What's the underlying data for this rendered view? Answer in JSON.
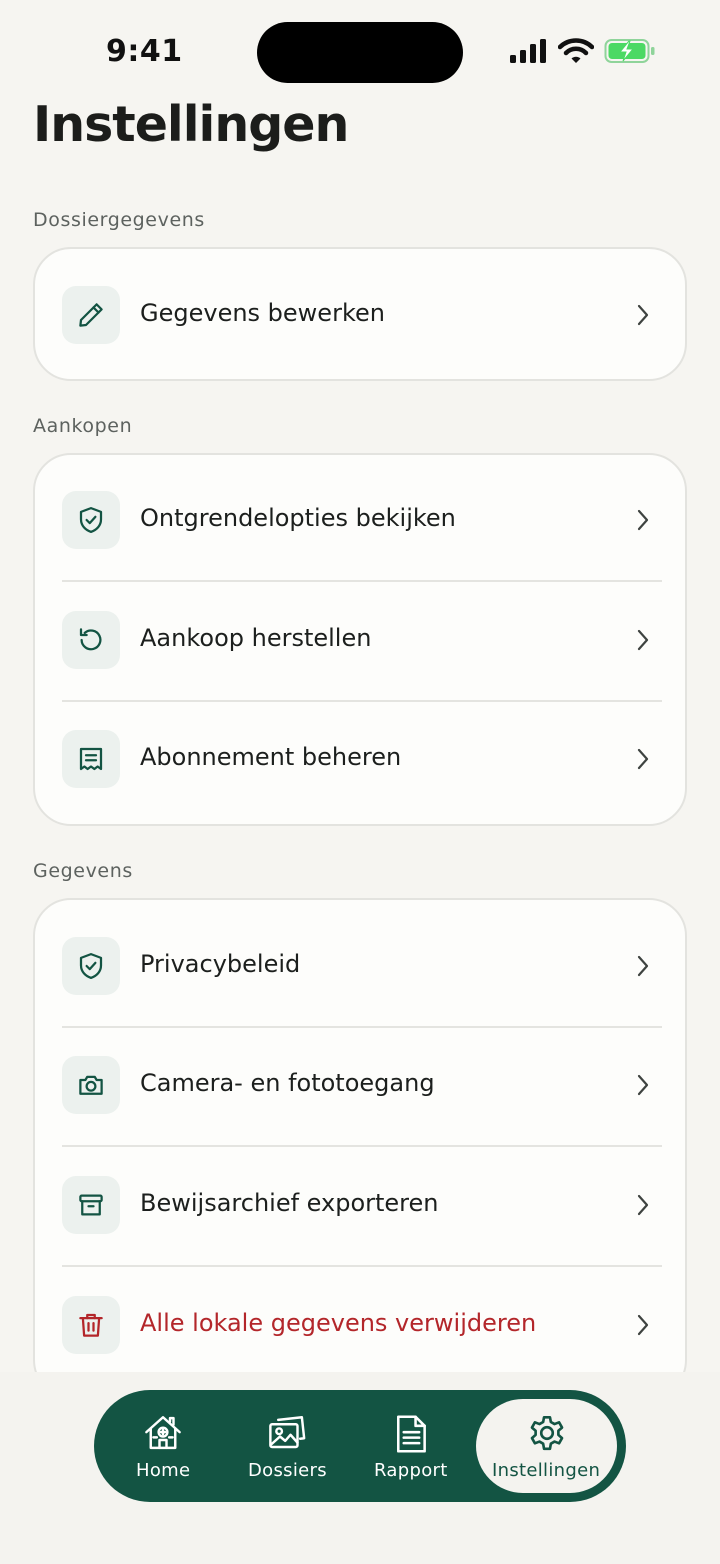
{
  "status_bar": {
    "time": "9:41"
  },
  "page": {
    "title": "Instellingen"
  },
  "sections": [
    {
      "label": "Dossiergegevens",
      "items": [
        {
          "label": "Gegevens bewerken",
          "icon": "pencil-icon"
        }
      ]
    },
    {
      "label": "Aankopen",
      "items": [
        {
          "label": "Ontgrendelopties bekijken",
          "icon": "shield-check-icon"
        },
        {
          "label": "Aankoop herstellen",
          "icon": "restore-icon"
        },
        {
          "label": "Abonnement beheren",
          "icon": "receipt-icon"
        }
      ]
    },
    {
      "label": "Gegevens",
      "items": [
        {
          "label": "Privacybeleid",
          "icon": "shield-check-icon"
        },
        {
          "label": "Camera- en fototoegang",
          "icon": "camera-icon"
        },
        {
          "label": "Bewijsarchief exporteren",
          "icon": "archive-icon"
        },
        {
          "label": "Alle lokale gegevens verwijderen",
          "icon": "trash-icon",
          "destructive": true
        }
      ]
    }
  ],
  "tabbar": {
    "active": "Instellingen",
    "tabs": [
      {
        "label": "Home",
        "icon": "house-icon"
      },
      {
        "label": "Dossiers",
        "icon": "photos-icon"
      },
      {
        "label": "Rapport",
        "icon": "document-icon"
      },
      {
        "label": "Instellingen",
        "icon": "gear-icon"
      }
    ]
  },
  "colors": {
    "accent": "#135443",
    "danger": "#b3262a",
    "background": "#f6f5f1",
    "card": "#fdfdfb",
    "icon_tile": "#ecf1ee",
    "battery": "#4cd964"
  }
}
